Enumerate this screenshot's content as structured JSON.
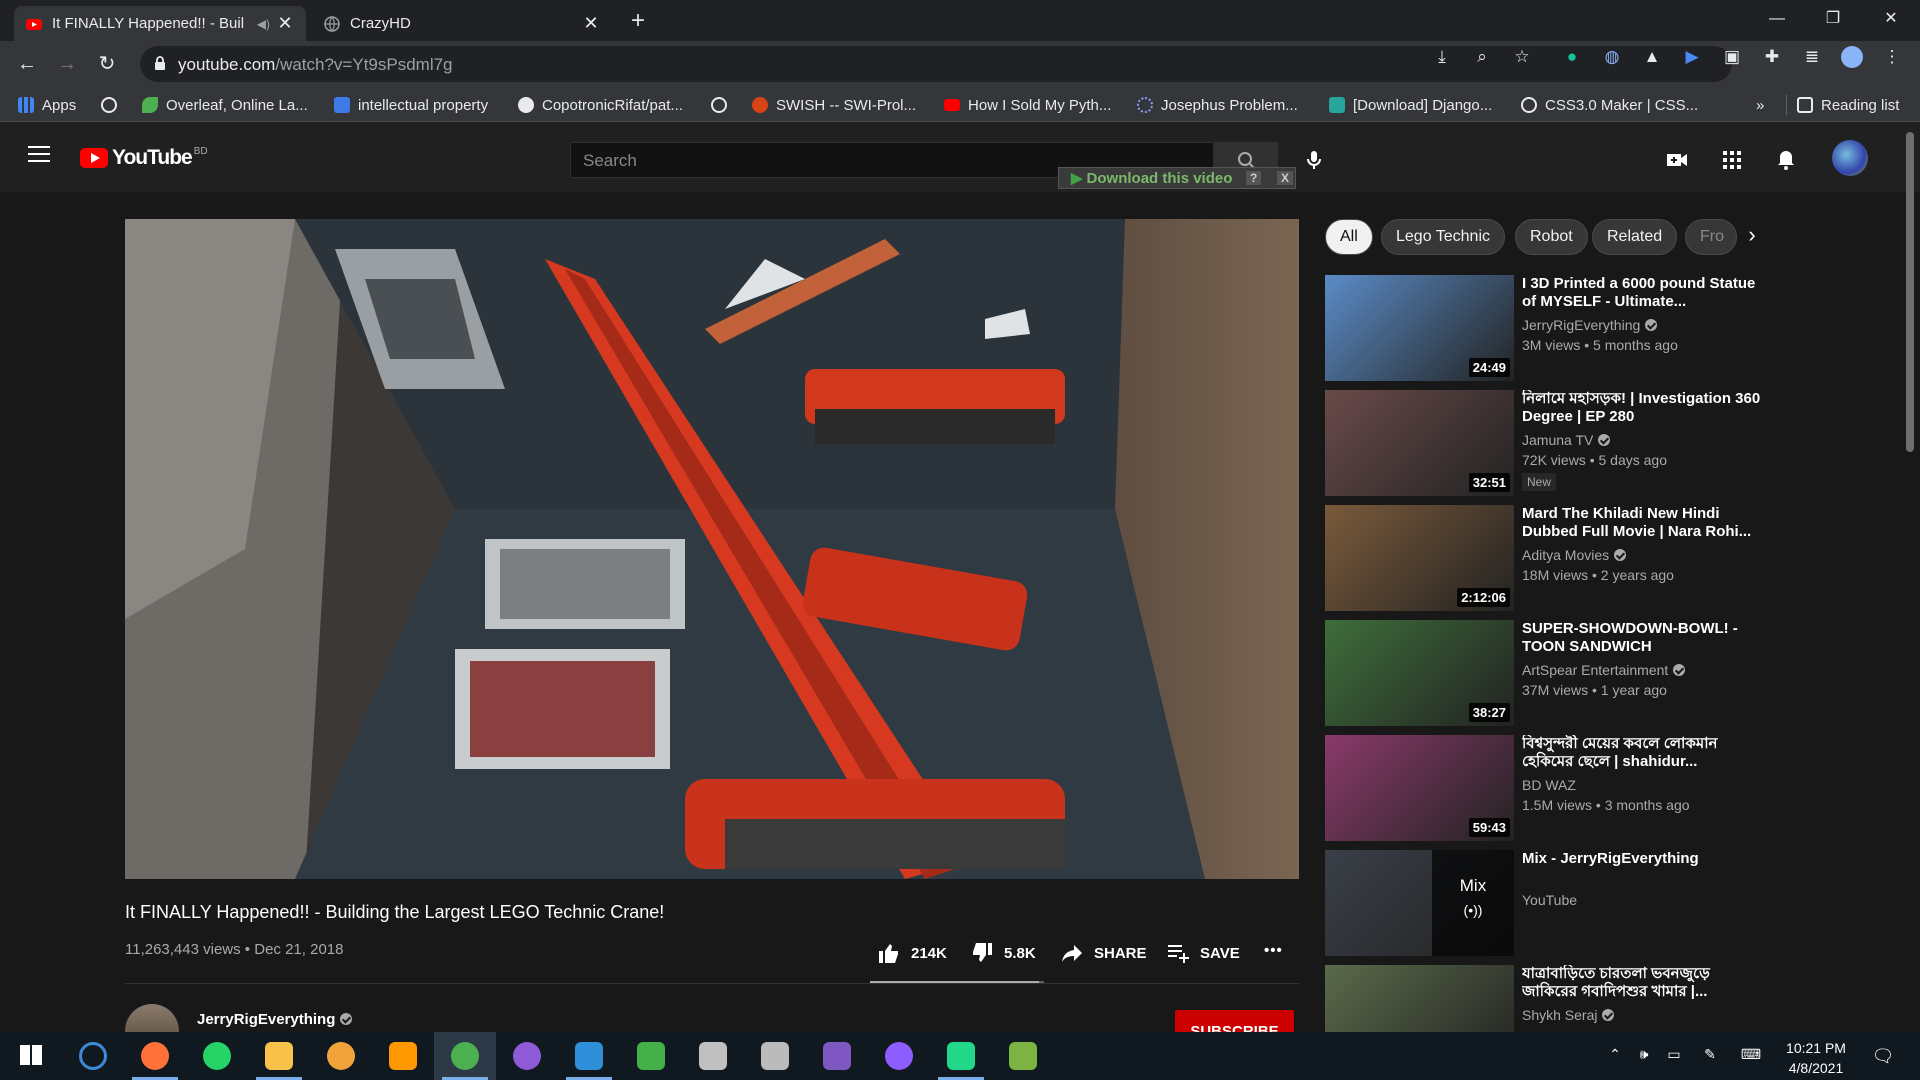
{
  "browser": {
    "tabs": [
      {
        "title": "It FINALLY Happened!! - Buil",
        "active": true
      },
      {
        "title": "CrazyHD",
        "active": false
      }
    ],
    "url_host": "youtube.com",
    "url_path": "/watch?v=Yt9sPsdml7g",
    "bookmarks": [
      {
        "label": "Apps",
        "color": "#4285f4"
      },
      {
        "label": "",
        "color": "#e8eaed"
      },
      {
        "label": "Overleaf, Online La...",
        "color": "#4caf50"
      },
      {
        "label": "intellectual property",
        "color": "#3f7be8"
      },
      {
        "label": "CopotronicRifat/pat...",
        "color": "#e8eaed"
      },
      {
        "label": "",
        "color": "#e8eaed"
      },
      {
        "label": "SWISH -- SWI-Prol...",
        "color": "#d84315"
      },
      {
        "label": "How I Sold My Pyth...",
        "color": "#ff0000"
      },
      {
        "label": "Josephus Problem...",
        "color": "#5c6bc0"
      },
      {
        "label": "[Download] Django...",
        "color": "#26a69a"
      },
      {
        "label": "CSS3.0 Maker | CSS...",
        "color": "#e8eaed"
      }
    ],
    "more_bookmarks": "»",
    "reading_list": "Reading list"
  },
  "youtube": {
    "logo_text": "YouTube",
    "country_code": "BD",
    "search_placeholder": "Search",
    "download_bar": {
      "label": "Download this video",
      "help": "?",
      "close": "X"
    }
  },
  "video": {
    "title": "It FINALLY Happened!! - Building the Largest LEGO Technic Crane!",
    "views": "11,263,443 views",
    "date": "Dec 21, 2018",
    "meta_separator": " • ",
    "likes": "214K",
    "dislikes": "5.8K",
    "like_ratio": 0.974,
    "share_label": "SHARE",
    "save_label": "SAVE",
    "more_label": "•••",
    "channel": "JerryRigEverything",
    "subscribe_label": "SUBSCRIBE"
  },
  "chips": [
    {
      "label": "All",
      "selected": true
    },
    {
      "label": "Lego Technic",
      "selected": false
    },
    {
      "label": "Robot",
      "selected": false
    },
    {
      "label": "Related",
      "selected": false
    },
    {
      "label": "Fro",
      "selected": false
    }
  ],
  "chip_next": "›",
  "recommendations": [
    {
      "title": "I 3D Printed a 6000 pound Statue of MYSELF - Ultimate...",
      "channel": "JerryRigEverything",
      "verified": true,
      "meta": "3M views • 5 months ago",
      "duration": "24:49",
      "badge": "",
      "thumb_color": "#5b8cc7"
    },
    {
      "title": "নিলামে মহাসড়ক! | Investigation 360 Degree | EP 280",
      "channel": "Jamuna TV",
      "verified": true,
      "meta": "72K views • 5 days ago",
      "duration": "32:51",
      "badge": "New",
      "thumb_color": "#6a4a4a"
    },
    {
      "title": "Mard The Khiladi New Hindi Dubbed Full Movie | Nara Rohi...",
      "channel": "Aditya Movies",
      "verified": true,
      "meta": "18M views • 2 years ago",
      "duration": "2:12:06",
      "badge": "",
      "thumb_color": "#7a5a3a"
    },
    {
      "title": "SUPER-SHOWDOWN-BOWL! - TOON SANDWICH",
      "channel": "ArtSpear Entertainment",
      "verified": true,
      "meta": "37M views • 1 year ago",
      "duration": "38:27",
      "badge": "",
      "thumb_color": "#3e6e3a"
    },
    {
      "title": "বিশ্বসুন্দরী মেয়ের কবলে লোকমান হেকিমের ছেলে | shahidur...",
      "channel": "BD WAZ",
      "verified": false,
      "meta": "1.5M views • 3 months ago",
      "duration": "59:43",
      "badge": "",
      "thumb_color": "#8a3a6a"
    },
    {
      "title": "Mix - JerryRigEverything",
      "channel": "YouTube",
      "verified": false,
      "meta": "",
      "duration": "",
      "badge": "",
      "thumb_color": "#3a3f48",
      "mix_label": "Mix",
      "mix_icon": "(•))"
    },
    {
      "title": "যাত্রাবাড়িতে চারতলা ভবনজুড়ে জাকিরের গবাদিপশুর খামার |...",
      "channel": "Shykh Seraj",
      "verified": true,
      "meta": "",
      "duration": "",
      "badge": "",
      "thumb_color": "#5a6a4a"
    }
  ],
  "taskbar": {
    "time": "10:21 PM",
    "date": "4/8/2021",
    "apps": [
      {
        "name": "start",
        "color": "#ffffff"
      },
      {
        "name": "cortana",
        "color": "#3c8ad8"
      },
      {
        "name": "firefox",
        "color": "#ff7139"
      },
      {
        "name": "whatsapp",
        "color": "#25d366"
      },
      {
        "name": "file-explorer",
        "color": "#f8c24a"
      },
      {
        "name": "brave",
        "color": "#f0a33a"
      },
      {
        "name": "sublime",
        "color": "#ff9800"
      },
      {
        "name": "chrome",
        "color": "#4caf50"
      },
      {
        "name": "github-desktop",
        "color": "#8e5ad8"
      },
      {
        "name": "vscode",
        "color": "#2f8fd8"
      },
      {
        "name": "anaconda",
        "color": "#43b049"
      },
      {
        "name": "spyder",
        "color": "#c0c0c0"
      },
      {
        "name": "inkscape",
        "color": "#bbbbbb"
      },
      {
        "name": "visual-studio",
        "color": "#7e57c2"
      },
      {
        "name": "messenger",
        "color": "#8e5dff"
      },
      {
        "name": "pycharm",
        "color": "#21d789"
      },
      {
        "name": "notepad",
        "color": "#7cb342"
      }
    ]
  }
}
